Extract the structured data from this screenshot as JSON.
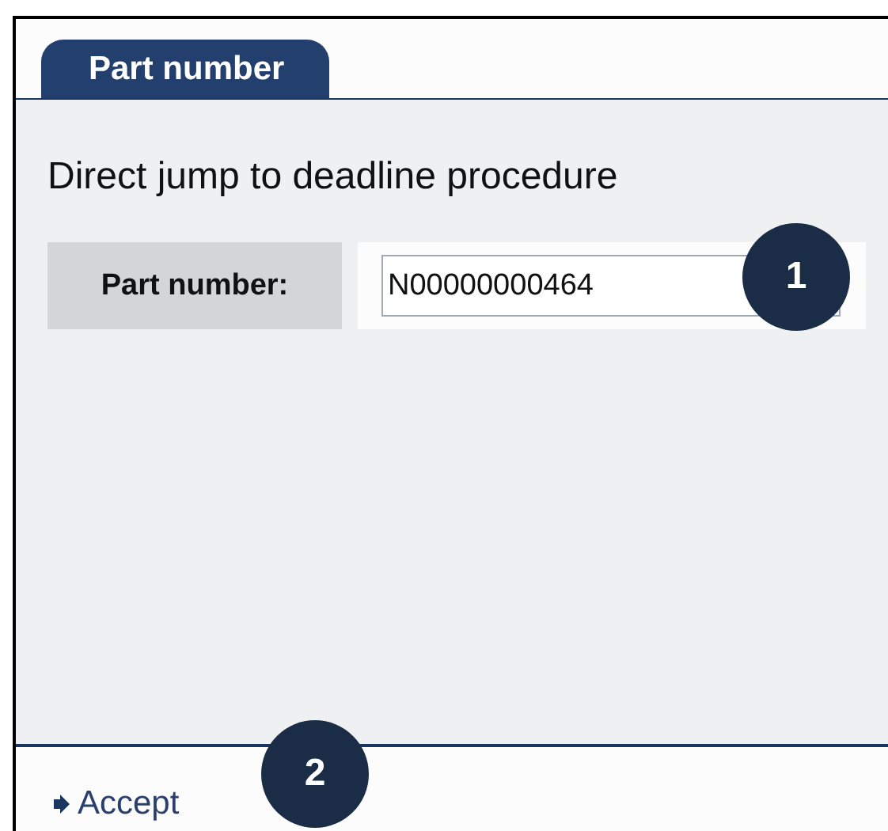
{
  "tabs": [
    {
      "label": "Part number",
      "selected": true
    }
  ],
  "heading": "Direct jump to deadline procedure",
  "field": {
    "label": "Part number:",
    "value": "N00000000464"
  },
  "footer": {
    "link": "Accept"
  },
  "callouts": [
    {
      "label": "1",
      "kind": "field"
    },
    {
      "label": "2",
      "kind": "footer"
    }
  ]
}
